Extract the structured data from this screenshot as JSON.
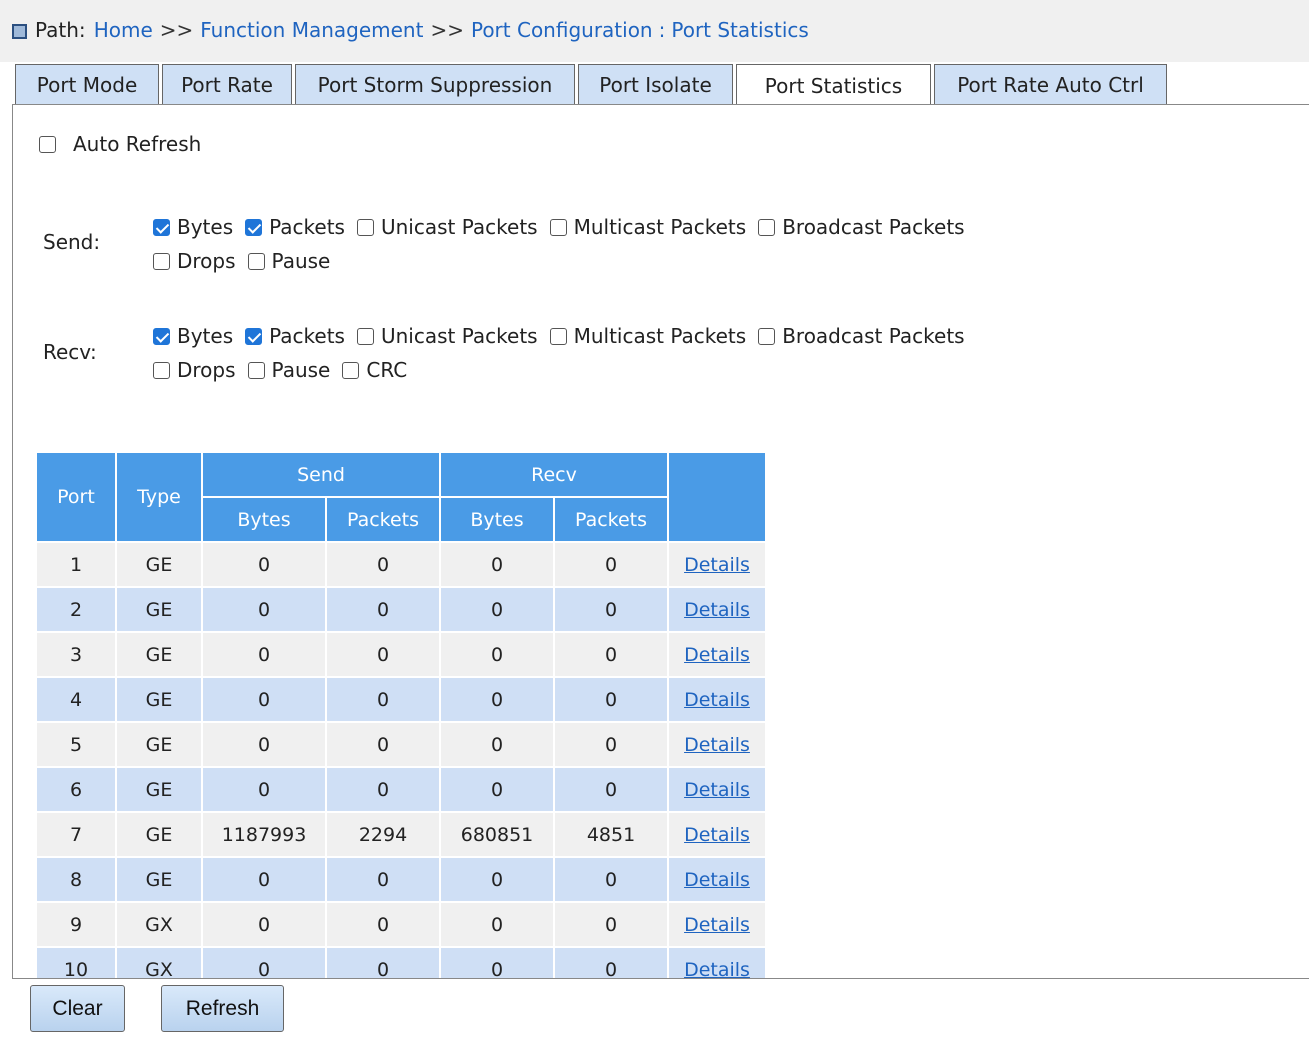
{
  "path": {
    "label": "Path:",
    "crumbs": [
      "Home",
      "Function Management",
      "Port Configuration"
    ],
    "separator": ">>",
    "colon": ":",
    "current": "Port Statistics"
  },
  "tabs": [
    {
      "label": "Port Mode"
    },
    {
      "label": "Port Rate"
    },
    {
      "label": "Port Storm Suppression"
    },
    {
      "label": "Port Isolate"
    },
    {
      "label": "Port Statistics",
      "active": true
    },
    {
      "label": "Port Rate Auto Ctrl"
    }
  ],
  "auto_refresh": {
    "label": "Auto Refresh",
    "checked": false
  },
  "send": {
    "label": "Send:",
    "options": [
      {
        "label": "Bytes",
        "checked": true
      },
      {
        "label": "Packets",
        "checked": true
      },
      {
        "label": "Unicast Packets",
        "checked": false
      },
      {
        "label": "Multicast Packets",
        "checked": false
      },
      {
        "label": "Broadcast Packets",
        "checked": false
      },
      {
        "label": "Drops",
        "checked": false
      },
      {
        "label": "Pause",
        "checked": false
      }
    ]
  },
  "recv": {
    "label": "Recv:",
    "options": [
      {
        "label": "Bytes",
        "checked": true
      },
      {
        "label": "Packets",
        "checked": true
      },
      {
        "label": "Unicast Packets",
        "checked": false
      },
      {
        "label": "Multicast Packets",
        "checked": false
      },
      {
        "label": "Broadcast Packets",
        "checked": false
      },
      {
        "label": "Drops",
        "checked": false
      },
      {
        "label": "Pause",
        "checked": false
      },
      {
        "label": "CRC",
        "checked": false
      }
    ]
  },
  "table": {
    "headers": {
      "port": "Port",
      "type": "Type",
      "send": "Send",
      "recv": "Recv",
      "send_bytes": "Bytes",
      "send_packets": "Packets",
      "recv_bytes": "Bytes",
      "recv_packets": "Packets"
    },
    "link_label": "Details",
    "rows": [
      {
        "port": "1",
        "type": "GE",
        "send_bytes": "0",
        "send_packets": "0",
        "recv_bytes": "0",
        "recv_packets": "0"
      },
      {
        "port": "2",
        "type": "GE",
        "send_bytes": "0",
        "send_packets": "0",
        "recv_bytes": "0",
        "recv_packets": "0"
      },
      {
        "port": "3",
        "type": "GE",
        "send_bytes": "0",
        "send_packets": "0",
        "recv_bytes": "0",
        "recv_packets": "0"
      },
      {
        "port": "4",
        "type": "GE",
        "send_bytes": "0",
        "send_packets": "0",
        "recv_bytes": "0",
        "recv_packets": "0"
      },
      {
        "port": "5",
        "type": "GE",
        "send_bytes": "0",
        "send_packets": "0",
        "recv_bytes": "0",
        "recv_packets": "0"
      },
      {
        "port": "6",
        "type": "GE",
        "send_bytes": "0",
        "send_packets": "0",
        "recv_bytes": "0",
        "recv_packets": "0"
      },
      {
        "port": "7",
        "type": "GE",
        "send_bytes": "1187993",
        "send_packets": "2294",
        "recv_bytes": "680851",
        "recv_packets": "4851"
      },
      {
        "port": "8",
        "type": "GE",
        "send_bytes": "0",
        "send_packets": "0",
        "recv_bytes": "0",
        "recv_packets": "0"
      },
      {
        "port": "9",
        "type": "GX",
        "send_bytes": "0",
        "send_packets": "0",
        "recv_bytes": "0",
        "recv_packets": "0"
      },
      {
        "port": "10",
        "type": "GX",
        "send_bytes": "0",
        "send_packets": "0",
        "recv_bytes": "0",
        "recv_packets": "0"
      }
    ]
  },
  "buttons": {
    "clear": "Clear",
    "refresh": "Refresh"
  }
}
